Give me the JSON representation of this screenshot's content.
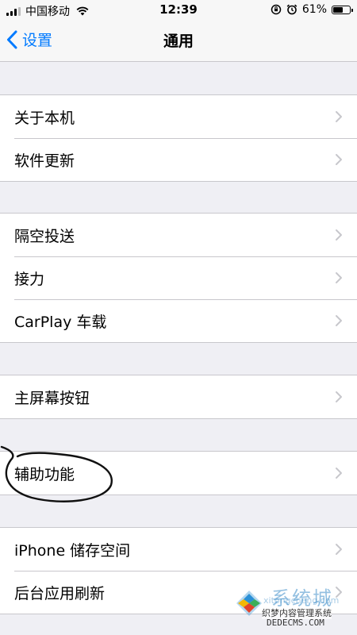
{
  "status_bar": {
    "carrier": "中国移动",
    "time": "12:39",
    "battery": "61%",
    "battery_level": 0.61,
    "icons": [
      "signal-icon",
      "wifi-icon",
      "lock-rotation-icon",
      "alarm-icon",
      "battery-icon"
    ]
  },
  "nav": {
    "back_label": "设置",
    "title": "通用"
  },
  "groups": [
    {
      "items": [
        {
          "label": "关于本机"
        },
        {
          "label": "软件更新"
        }
      ]
    },
    {
      "items": [
        {
          "label": "隔空投送"
        },
        {
          "label": "接力"
        },
        {
          "label": "CarPlay 车载"
        }
      ]
    },
    {
      "items": [
        {
          "label": "主屏幕按钮"
        }
      ]
    },
    {
      "items": [
        {
          "label": "辅助功能"
        }
      ]
    },
    {
      "items": [
        {
          "label": "iPhone 储存空间"
        },
        {
          "label": "后台应用刷新"
        }
      ]
    }
  ],
  "watermark": {
    "brand": "系统城",
    "url": "xitongcheng.com",
    "cn": "织梦内容管理系统",
    "domain": "DEDECMS.COM"
  },
  "colors": {
    "accent": "#007aff",
    "background": "#efeff4",
    "separator": "#c8c7cc",
    "chevron": "#c7c7cc"
  }
}
